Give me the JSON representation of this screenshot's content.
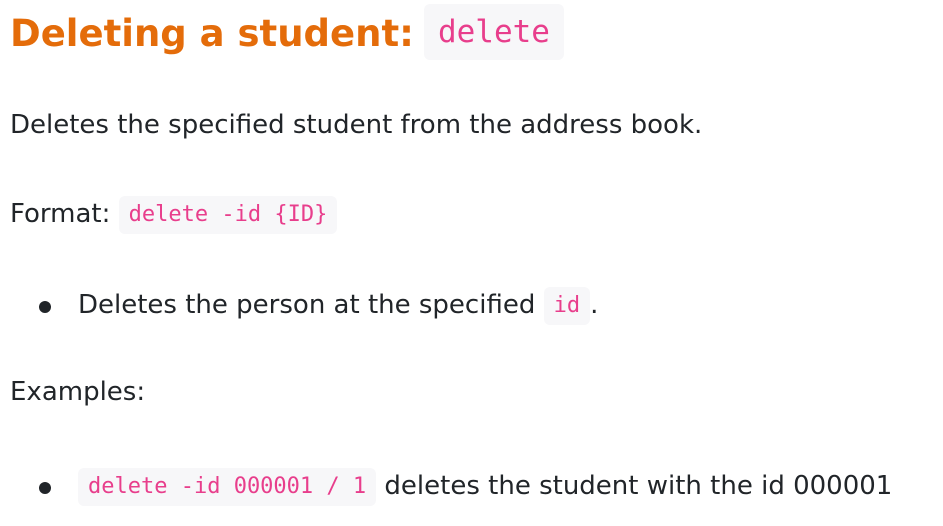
{
  "heading": {
    "text": "Deleting a student:",
    "command": "delete"
  },
  "description": "Deletes the specified student from the address book.",
  "format": {
    "label": "Format:",
    "code": "delete -id {ID}"
  },
  "format_notes": [
    {
      "text_before": "Deletes the person at the specified",
      "code": "id",
      "text_after": "."
    }
  ],
  "examples": {
    "label": "Examples:",
    "items": [
      {
        "code": "delete -id 000001 / 1",
        "text": "deletes the student with the id 000001"
      }
    ]
  },
  "colors": {
    "heading": "#e46c0a",
    "code_text": "#e83e8c",
    "code_background": "#f7f7f9",
    "body_text": "#212529"
  }
}
